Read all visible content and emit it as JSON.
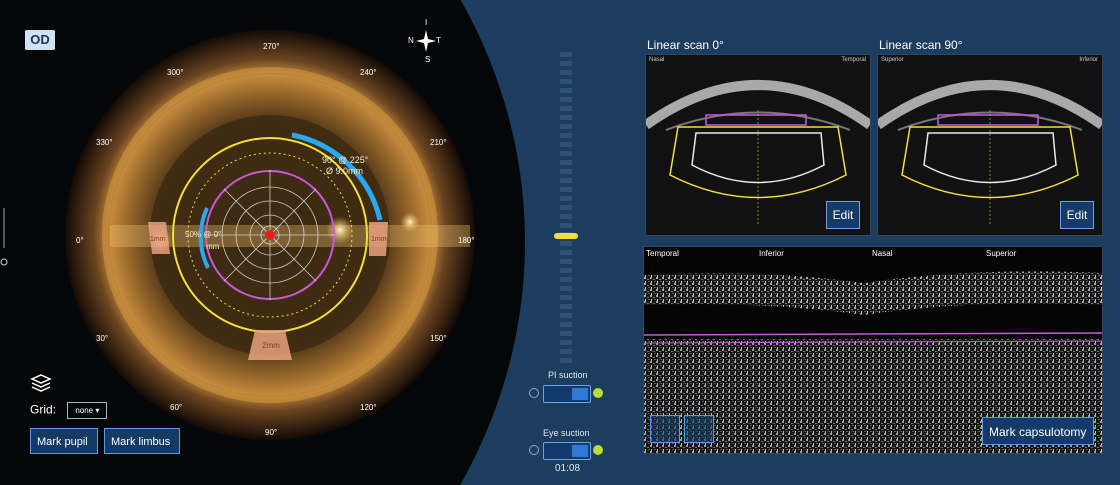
{
  "left_panel": {
    "eye_label": "OD",
    "compass": {
      "n": "N",
      "t": "T",
      "i": "I",
      "s": "S"
    },
    "degree_labels": [
      {
        "text": "270°"
      },
      {
        "text": "240°"
      },
      {
        "text": "300°"
      },
      {
        "text": "210°"
      },
      {
        "text": "330°"
      },
      {
        "text": "0°"
      },
      {
        "text": "180°"
      },
      {
        "text": "30°"
      },
      {
        "text": "150°"
      },
      {
        "text": "60°"
      },
      {
        "text": "120°"
      },
      {
        "text": "90°"
      }
    ],
    "overlay_labels": {
      "arc_info_1": "90° @ 225°",
      "arc_info_2": "Ø 9.0mm",
      "center_info_1": "50% @ 0°",
      "center_info_2": "mm",
      "marker_left": "1mm",
      "marker_right": "1mm",
      "marker_bottom": "2mm"
    },
    "grid_label": "Grid:",
    "grid_value": "none ▾",
    "mark_pupil": "Mark pupil",
    "mark_limbus": "Mark limbus"
  },
  "middle": {
    "pi_suction": "PI suction",
    "eye_suction": "Eye suction",
    "timer": "01:08"
  },
  "scans": {
    "scan0_title": "Linear scan 0°",
    "scan90_title": "Linear scan 90°",
    "scan0_left": "Nasal",
    "scan0_right": "Temporal",
    "scan90_left": "Superior",
    "scan90_right": "Inferior",
    "edit": "Edit"
  },
  "bottom_scan": {
    "labels": [
      "Temporal",
      "Inferior",
      "Nasal",
      "Superior"
    ],
    "mark_capsulotomy": "Mark capsulotomy"
  },
  "colors": {
    "background": "#1d3d5e",
    "yellow": "#f2e03a",
    "magenta": "#c65ad8",
    "cyan": "#2aa9f0",
    "green": "#b8dc3a"
  }
}
